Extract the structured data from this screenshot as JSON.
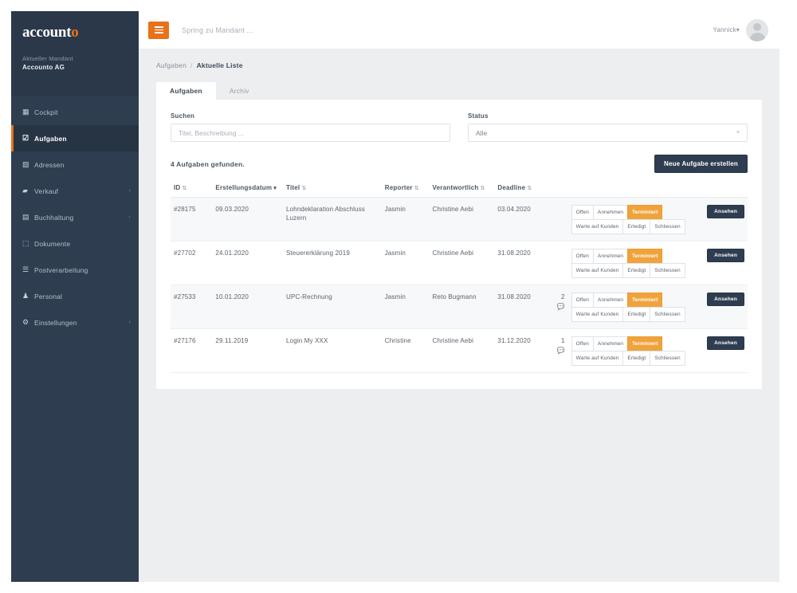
{
  "brand": {
    "logo_main": "account",
    "logo_accent": "o",
    "accent_color": "#e8711a",
    "sidebar_color": "#2e3d50",
    "status_active_color": "#f0a33c"
  },
  "sidebar": {
    "mandant_label": "Aktueller Mandant",
    "mandant_name": "Accounto AG",
    "items": [
      {
        "label": "Cockpit",
        "icon": "grid-icon",
        "active": false,
        "expandable": false
      },
      {
        "label": "Aufgaben",
        "icon": "tasks-icon",
        "active": true,
        "expandable": false
      },
      {
        "label": "Adressen",
        "icon": "contact-icon",
        "active": false,
        "expandable": false
      },
      {
        "label": "Verkauf",
        "icon": "folder-icon",
        "active": false,
        "expandable": true
      },
      {
        "label": "Buchhaltung",
        "icon": "book-icon",
        "active": false,
        "expandable": true
      },
      {
        "label": "Dokumente",
        "icon": "document-icon",
        "active": false,
        "expandable": false
      },
      {
        "label": "Postverarbeitung",
        "icon": "mail-icon",
        "active": false,
        "expandable": false
      },
      {
        "label": "Personal",
        "icon": "person-icon",
        "active": false,
        "expandable": false
      },
      {
        "label": "Einstellungen",
        "icon": "gear-icon",
        "active": false,
        "expandable": true
      }
    ]
  },
  "topbar": {
    "menu_icon": "hamburger-icon",
    "jump_placeholder": "Spring zu Mandant ...",
    "user_name": "Yannick",
    "user_caret": "▾",
    "avatar_icon": "avatar-icon"
  },
  "breadcrumb": {
    "parent": "Aufgaben",
    "separator": "/",
    "current": "Aktuelle Liste"
  },
  "tabs": [
    {
      "label": "Aufgaben",
      "active": true
    },
    {
      "label": "Archiv",
      "active": false
    }
  ],
  "filters": {
    "search_label": "Suchen",
    "search_placeholder": "Titel, Beschreibung ...",
    "search_value": "",
    "status_label": "Status",
    "status_value": "Alle",
    "status_caret": "×"
  },
  "results": {
    "count_text": "4 Aufgaben gefunden.",
    "new_task_button": "Neue Aufgabe erstellen"
  },
  "table": {
    "columns": [
      {
        "label": "ID",
        "sort": "both"
      },
      {
        "label": "Erstellungsdatum",
        "sort": "desc"
      },
      {
        "label": "Titel",
        "sort": "both"
      },
      {
        "label": "Reporter",
        "sort": "both"
      },
      {
        "label": "Verantwortlich",
        "sort": "both"
      },
      {
        "label": "Deadline",
        "sort": "both"
      }
    ],
    "sort_glyph": "⇅",
    "sort_desc_glyph": "▾",
    "status_buttons": [
      "Offen",
      "Annehmen",
      "Terminiert",
      "Warte auf Kunden",
      "Erledigt",
      "Schliessen"
    ],
    "active_status": "Terminiert",
    "view_button": "Ansehen",
    "comment_icon": "comment-icon",
    "rows": [
      {
        "id": "#28175",
        "created": "09.03.2020",
        "title": "Lohndeklaration Abschluss Luzern",
        "reporter": "Jasmin",
        "responsible": "Christine Aebi",
        "deadline": "03.04.2020",
        "comments": ""
      },
      {
        "id": "#27702",
        "created": "24.01.2020",
        "title": "Steuererklärung 2019",
        "reporter": "Jasmin",
        "responsible": "Christine Aebi",
        "deadline": "31.08.2020",
        "comments": ""
      },
      {
        "id": "#27533",
        "created": "10.01.2020",
        "title": "UPC-Rechnung",
        "reporter": "Jasmin",
        "responsible": "Reto Bugmann",
        "deadline": "31.08.2020",
        "comments": "2"
      },
      {
        "id": "#27176",
        "created": "29.11.2019",
        "title": "Login My XXX",
        "reporter": "Christine",
        "responsible": "Christine Aebi",
        "deadline": "31.12.2020",
        "comments": "1"
      }
    ]
  }
}
